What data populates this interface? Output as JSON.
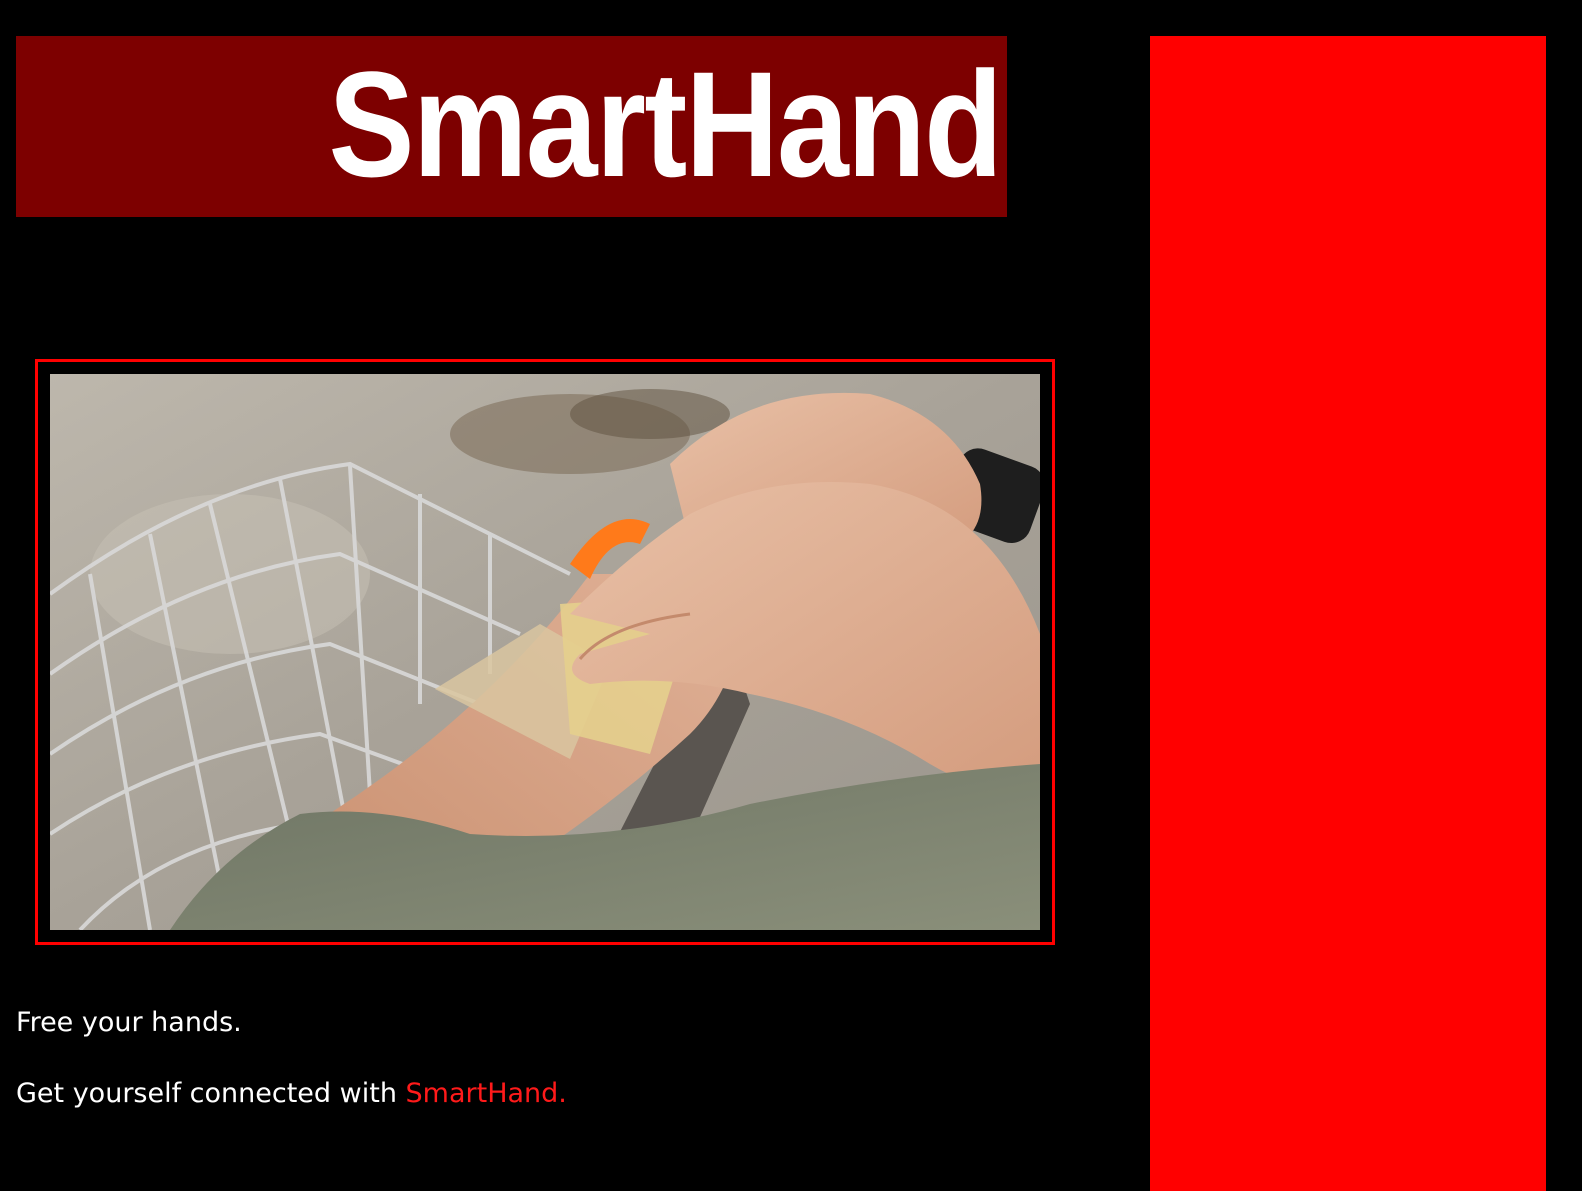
{
  "banner": {
    "title": "SmartHand"
  },
  "video": {
    "description_icon": "video-thumbnail"
  },
  "captions": {
    "line1": "Free your hands.",
    "line2_prefix": "Get yourself connected with ",
    "line2_brand": "SmartHand."
  },
  "colors": {
    "background": "#000000",
    "banner": "#7d0000",
    "accent": "#ff0000",
    "text": "#ffffff"
  }
}
